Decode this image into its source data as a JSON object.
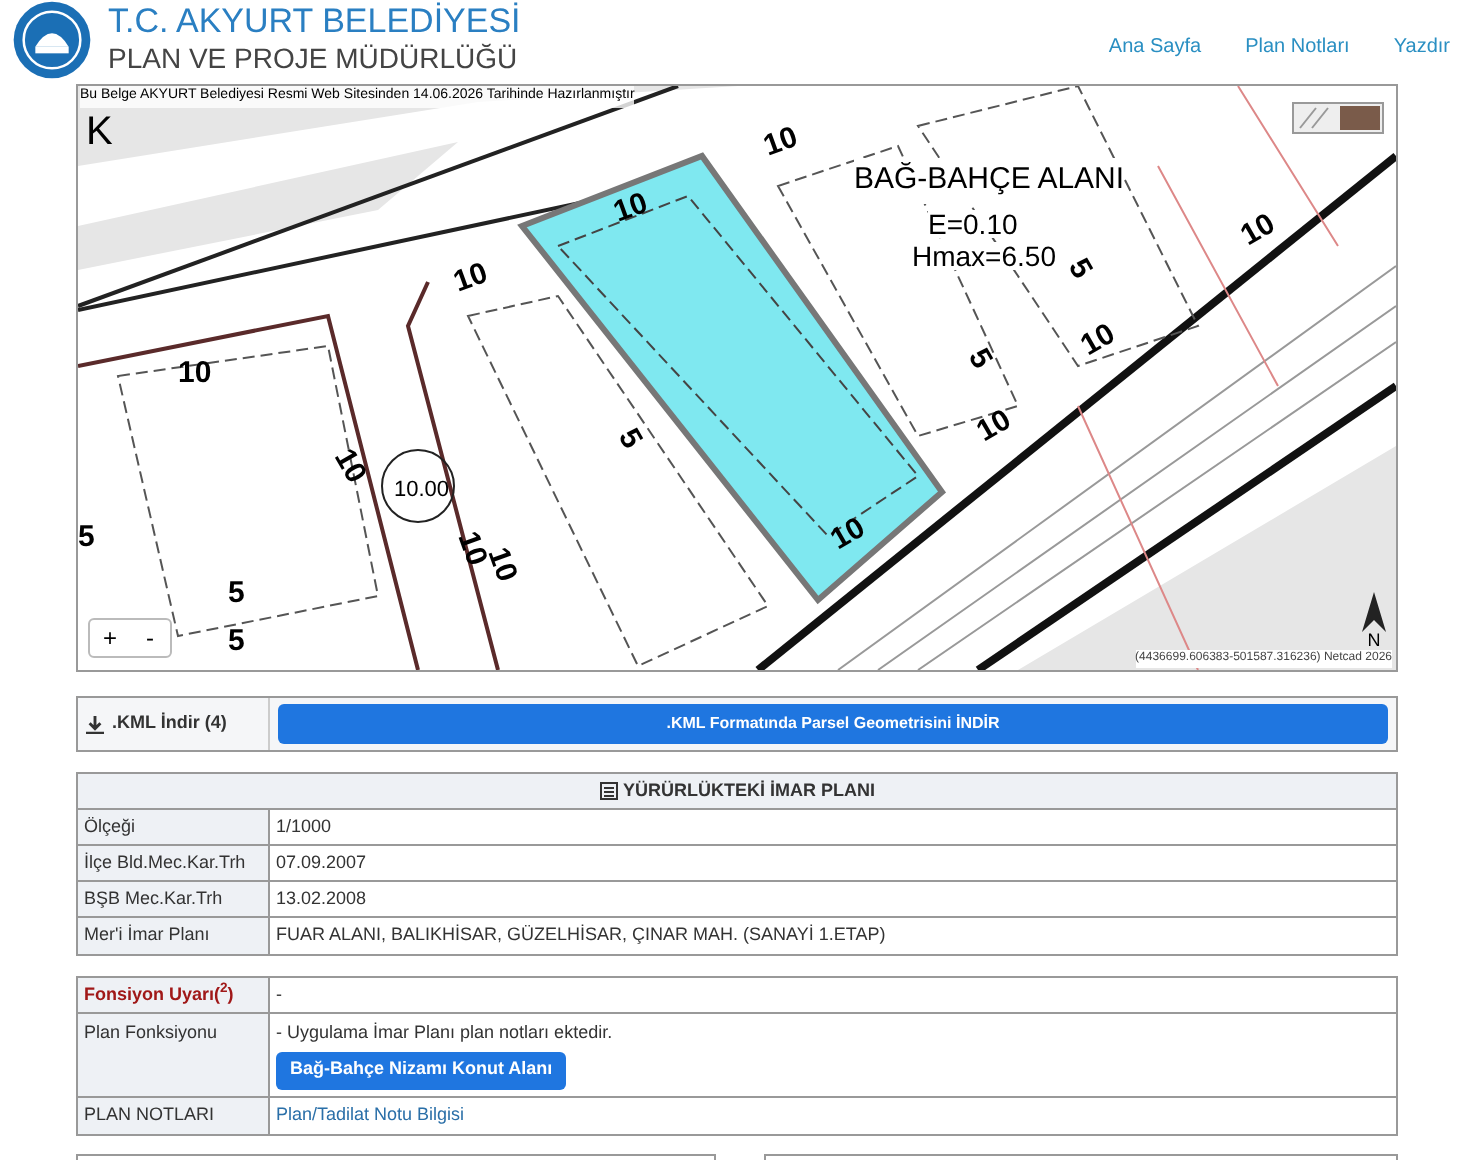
{
  "header": {
    "title": "T.C. AKYURT BELEDİYESİ",
    "subtitle": "PLAN VE PROJE MÜDÜRLÜĞÜ",
    "nav": [
      "Ana Sayfa",
      "Plan Notları",
      "Yazdır"
    ]
  },
  "map": {
    "note": "Bu Belge AKYURT Belediyesi Resmi Web Sitesinden 14.06.2026 Tarihinde Hazırlanmıştır",
    "north_letter": "K",
    "zone_title": "BAĞ-BAHÇE ALANI",
    "zone_e": "E=0.10",
    "zone_hmax": "Hmax=6.50",
    "coordinates": "(4436699.606383-501587.316236) Netcad 2026",
    "zoom_in": "+",
    "zoom_out": "-",
    "compass": "N",
    "road_marker": "10.00",
    "labels": [
      "10",
      "10",
      "10",
      "10",
      "10",
      "10",
      "10",
      "10",
      "10",
      "10",
      "10",
      "5",
      "5",
      "5",
      "5",
      "5",
      "5"
    ]
  },
  "kml": {
    "label": ".KML İndir (4)",
    "button": ".KML Formatında Parsel Geometrisini İNDİR"
  },
  "plan_table": {
    "title": "YÜRÜRLÜKTEKİ İMAR PLANI",
    "rows": [
      {
        "label": "Ölçeği",
        "value": "1/1000"
      },
      {
        "label": "İlçe Bld.Mec.Kar.Trh",
        "value": "07.09.2007"
      },
      {
        "label": "BŞB Mec.Kar.Trh",
        "value": "13.02.2008"
      },
      {
        "label": "Mer'i İmar Planı",
        "value": "FUAR ALANI, BALIKHİSAR, GÜZELHİSAR, ÇINAR MAH. (SANAYİ 1.ETAP)"
      }
    ]
  },
  "function_table": {
    "warning_label": "Fonsiyon Uyarı($^{2}$)",
    "warning_value": "-",
    "function_label": "Plan Fonksiyonu",
    "function_text": "- Uygulama İmar Planı plan notları ektedir.",
    "function_button": "Bağ-Bahçe Nizamı Konut Alanı",
    "notes_label": "PLAN NOTLARI",
    "notes_link": "Plan/Tadilat Notu Bilgisi"
  }
}
